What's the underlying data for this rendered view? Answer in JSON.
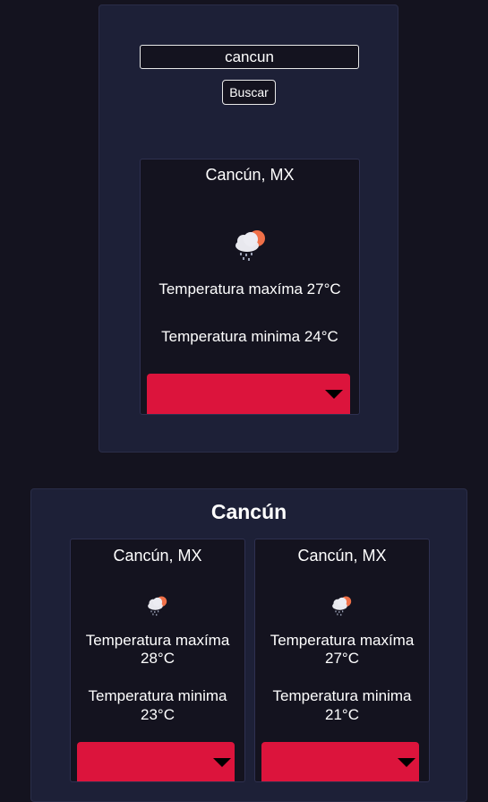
{
  "search": {
    "value": "cancun",
    "button_label": "Buscar"
  },
  "current": {
    "city": "Cancún, MX",
    "icon": "rain-cloud-sun-icon",
    "max_label": "Temperatura maxíma 27°C",
    "min_label": "Temperatura minima 24°C"
  },
  "forecast": {
    "title": "Cancún",
    "days": [
      {
        "city": "Cancún, MX",
        "icon": "rain-cloud-sun-icon",
        "max_label": "Temperatura maxíma",
        "max_value": "28°C",
        "min_label": "Temperatura minima",
        "min_value": "23°C"
      },
      {
        "city": "Cancún, MX",
        "icon": "rain-cloud-sun-icon",
        "max_label": "Temperatura maxíma",
        "max_value": "27°C",
        "min_label": "Temperatura minima",
        "min_value": "21°C"
      }
    ]
  },
  "colors": {
    "background": "#14131f",
    "panel": "#1d2037",
    "accent": "#dc143c"
  }
}
